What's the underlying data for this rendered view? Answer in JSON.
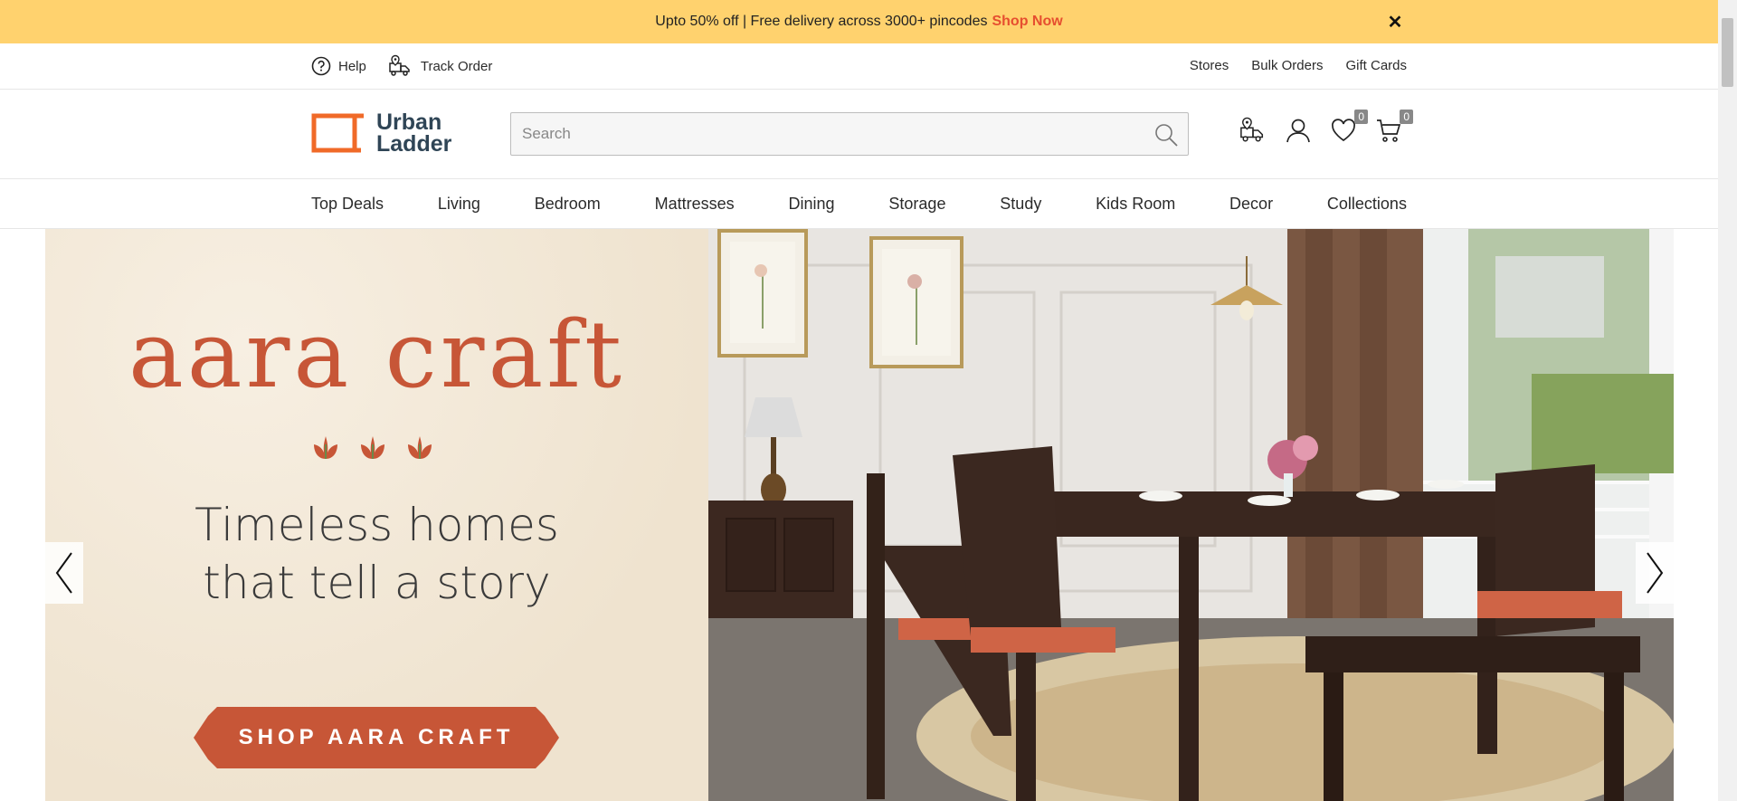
{
  "promo": {
    "text": "Upto 50% off | Free delivery across 3000+ pincodes",
    "link": "Shop Now",
    "close_icon": "close-icon"
  },
  "util_left": {
    "help": "Help",
    "track_order": "Track Order"
  },
  "util_right": {
    "stores": "Stores",
    "bulk_orders": "Bulk Orders",
    "gift_cards": "Gift Cards"
  },
  "brand": {
    "line1": "Urban",
    "line2": "Ladder",
    "color": "#f06a28"
  },
  "search": {
    "placeholder": "Search"
  },
  "header_icons": {
    "wishlist_count": "0",
    "cart_count": "0"
  },
  "nav": [
    "Top Deals",
    "Living",
    "Bedroom",
    "Mattresses",
    "Dining",
    "Storage",
    "Study",
    "Kids Room",
    "Decor",
    "Collections"
  ],
  "hero": {
    "title": "aara craft",
    "tagline1": "Timeless homes",
    "tagline2": "that tell a story",
    "cta": "SHOP AARA CRAFT",
    "accent": "#c75637"
  }
}
